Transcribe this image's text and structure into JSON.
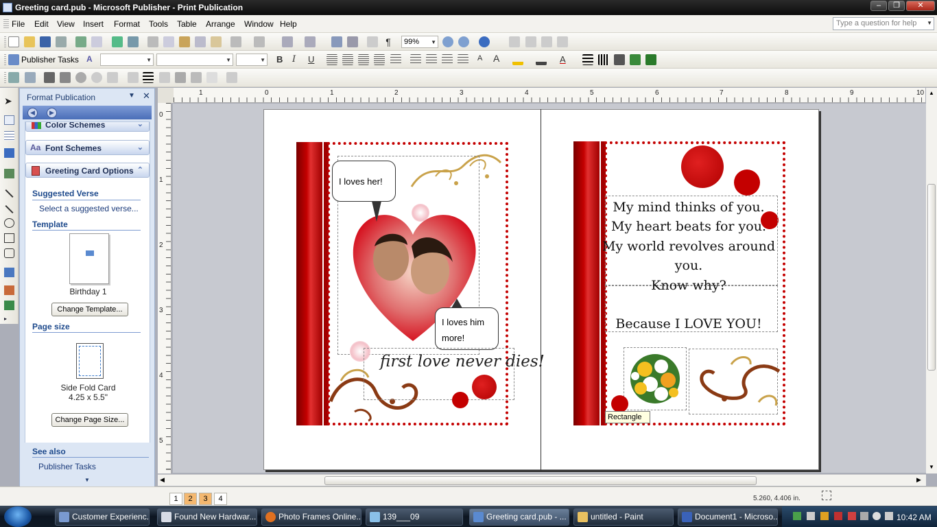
{
  "window": {
    "title": "Greeting card.pub - Microsoft Publisher - Print Publication"
  },
  "menu": [
    "File",
    "Edit",
    "View",
    "Insert",
    "Format",
    "Tools",
    "Table",
    "Arrange",
    "Window",
    "Help"
  ],
  "help_box": {
    "placeholder": "Type a question for help"
  },
  "toolbar": {
    "zoom": "99%",
    "publisher_tasks": "Publisher Tasks"
  },
  "taskpane": {
    "title": "Format Publication",
    "sections": {
      "color_schemes": "Color Schemes",
      "font_schemes": "Font Schemes",
      "greeting_card_options": "Greeting Card Options"
    },
    "suggested_verse_title": "Suggested Verse",
    "suggested_verse_link": "Select a suggested verse...",
    "template_title": "Template",
    "template_name": "Birthday  1",
    "change_template_btn": "Change Template...",
    "page_size_title": "Page size",
    "page_size_name": "Side Fold Card",
    "page_size_dims": "4.25 x 5.5\"",
    "change_page_size_btn": "Change Page Size...",
    "see_also_title": "See also",
    "see_also_link": "Publisher Tasks"
  },
  "rulers": {
    "h": [
      "1",
      "0",
      "1",
      "2",
      "3",
      "4",
      "5",
      "6",
      "7",
      "8",
      "9",
      "10"
    ],
    "v": [
      "0",
      "1",
      "2",
      "3",
      "4",
      "5"
    ]
  },
  "card": {
    "bubble1": "I loves her!",
    "bubble2": "I loves him more!",
    "tagline": "first love never dies!",
    "verse_lines": [
      "My mind thinks of you.",
      "My heart beats for you.",
      "My world revolves around",
      "you.",
      "Know why?",
      "",
      "Because I LOVE YOU!"
    ],
    "tooltip": "Rectangle"
  },
  "status": {
    "pages": [
      "1",
      "2",
      "3",
      "4"
    ],
    "coords": "5.260, 4.406 in."
  },
  "taskbar": {
    "tasks": [
      "Customer Experienc...",
      "Found New Hardwar...",
      "Photo Frames Online...",
      "139___09",
      "Greeting card.pub - ...",
      "untitled - Paint",
      "Document1 - Microso..."
    ],
    "clock": "10:42 AM"
  },
  "colors": {
    "accent_red": "#c40000",
    "dark_red": "#8c0000",
    "gold": "#c9a24a",
    "brown": "#8a3a14"
  }
}
